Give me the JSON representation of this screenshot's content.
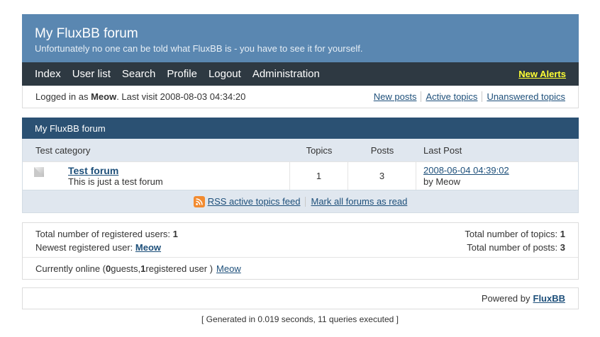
{
  "board": {
    "title": "My FluxBB forum",
    "description": "Unfortunately no one can be told what FluxBB is - you have to see it for yourself."
  },
  "menu": {
    "items": [
      "Index",
      "User list",
      "Search",
      "Profile",
      "Logout",
      "Administration"
    ],
    "alerts": "New Alerts"
  },
  "status": {
    "logged_prefix": "Logged in as ",
    "user": "Meow",
    "last_visit": ". Last visit 2008-08-03 04:34:20",
    "links": [
      "New posts",
      "Active topics",
      "Unanswered topics"
    ]
  },
  "forum_block": {
    "heading": "My FluxBB forum",
    "category": "Test category",
    "columns": {
      "topics": "Topics",
      "posts": "Posts",
      "last_post": "Last Post"
    },
    "forums": [
      {
        "name": "Test forum",
        "description": "This is just a test forum",
        "topics": "1",
        "posts": "3",
        "last_post_date": "2008-06-04 04:39:02",
        "last_post_by": "by Meow"
      }
    ],
    "feed_link": "RSS active topics feed",
    "mark_read": "Mark all forums as read"
  },
  "stats": {
    "registered_label": "Total number of registered users: ",
    "registered_value": "1",
    "newest_label": "Newest registered user: ",
    "newest_value": "Meow",
    "topics_label": "Total number of topics: ",
    "topics_value": "1",
    "posts_label": "Total number of posts: ",
    "posts_value": "3",
    "online_prefix": "Currently online ( ",
    "guests_value": "0",
    "guests_label": " guests, ",
    "registered_online_value": "1",
    "registered_online_label": " registered user )",
    "online_user": "Meow"
  },
  "footer": {
    "powered_label": "Powered by",
    "powered_link": "FluxBB",
    "generated": "[ Generated in 0.019 seconds, 11 queries executed ]"
  },
  "colors": {
    "header": "#5a87b1",
    "menu": "#2e3942",
    "forum_heading": "#2b5173",
    "alerts": "#ffff33",
    "rss": "#f28b30"
  },
  "icons": {
    "forum_status": "forum-status-icon",
    "rss": "rss-icon"
  }
}
